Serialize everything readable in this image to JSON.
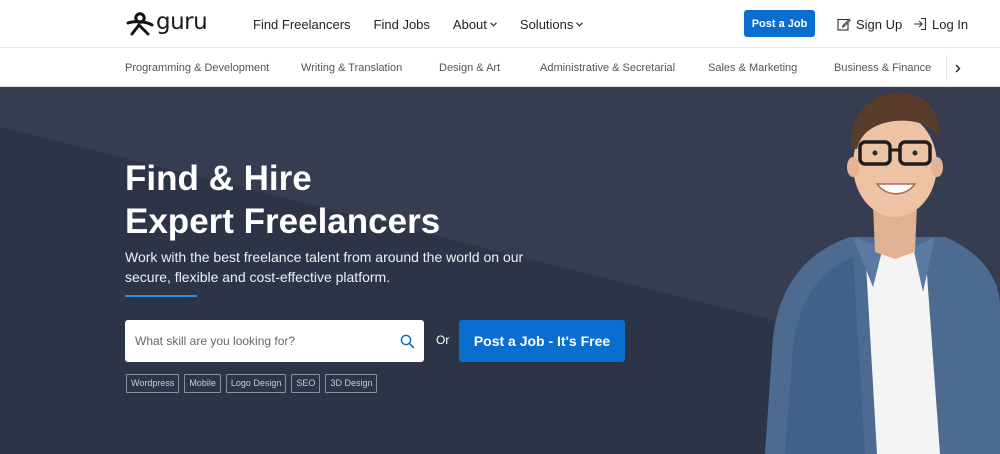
{
  "brand": {
    "name": "guru"
  },
  "header": {
    "nav": [
      {
        "label": "Find Freelancers",
        "caret": false
      },
      {
        "label": "Find Jobs",
        "caret": false
      },
      {
        "label": "About",
        "caret": true
      },
      {
        "label": "Solutions",
        "caret": true
      }
    ],
    "post_job_label": "Post a Job",
    "sign_up_label": "Sign Up",
    "log_in_label": "Log In"
  },
  "categories": [
    "Programming & Development",
    "Writing & Translation",
    "Design & Art",
    "Administrative & Secretarial",
    "Sales & Marketing",
    "Business & Finance"
  ],
  "hero": {
    "title_line1": "Find & Hire",
    "title_line2": "Expert Freelancers",
    "subtitle": "Work with the best freelance talent from around the world on our secure, flexible and cost-effective platform.",
    "search_placeholder": "What skill are you looking for?",
    "or_label": "Or",
    "cta_label": "Post a Job - It's Free",
    "tags": [
      "Wordpress",
      "Mobile",
      "Logo Design",
      "SEO",
      "3D Design"
    ]
  },
  "icons": {
    "logo": "guru-logo-icon",
    "search": "search-icon",
    "signup": "edit-icon",
    "login": "login-icon",
    "caret": "chevron-down-icon",
    "scroll": "chevron-right-icon"
  },
  "colors": {
    "accent": "#0a6ed1",
    "hero_bg": "#2e3448",
    "hero_bg_light": "#363d51",
    "underline": "#2f8be6"
  }
}
